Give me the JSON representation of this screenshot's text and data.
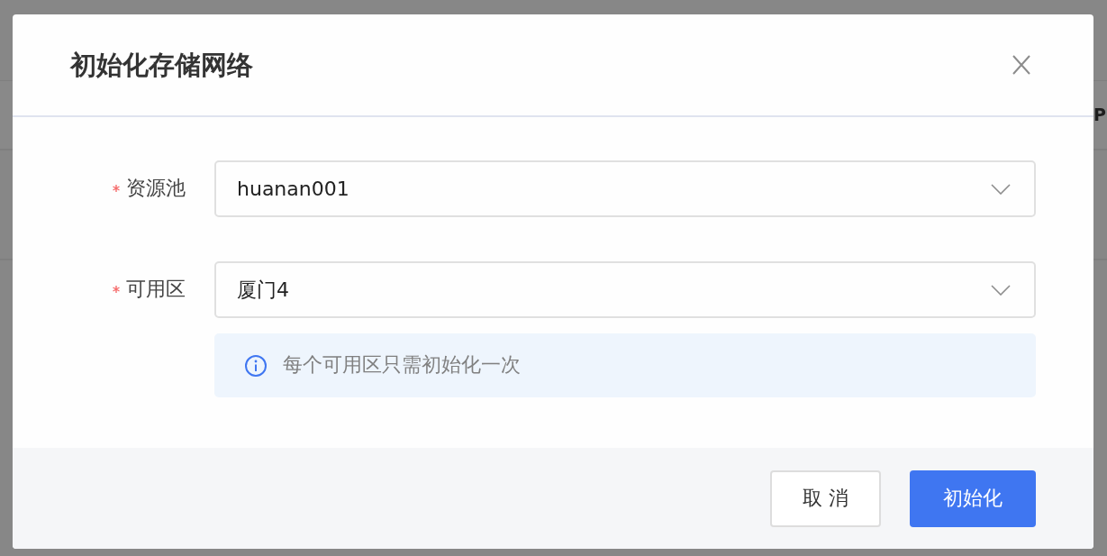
{
  "background": {
    "column_header_fragment": "P"
  },
  "dialog": {
    "title": "初始化存储网络",
    "fields": [
      {
        "label": "资源池",
        "required": true,
        "value": "huanan001"
      },
      {
        "label": "可用区",
        "required": true,
        "value": "厦门4"
      }
    ],
    "notice": "每个可用区只需初始化一次",
    "buttons": [
      {
        "label": "取 消",
        "kind": "secondary"
      },
      {
        "label": "初始化",
        "kind": "primary"
      }
    ]
  }
}
